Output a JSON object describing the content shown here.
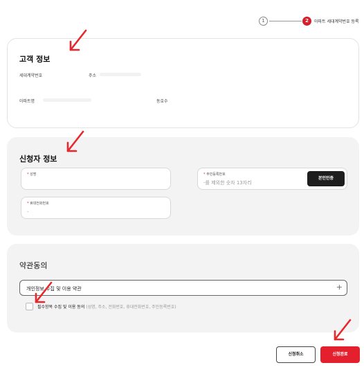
{
  "stepper": {
    "step1_number": "1",
    "step2_number": "2",
    "step2_label": "아파트 세대계약번호 등록"
  },
  "customer": {
    "title": "고객 정보",
    "contract_label": "세대계약번호",
    "address_label": "주소",
    "apartment_label": "아파트명",
    "dong_ho_label": "동호수"
  },
  "applicant": {
    "title": "신청자 정보",
    "name_label": "성명",
    "phone_label": "휴대전화번호",
    "resident_label": "주민등록번호",
    "resident_placeholder": "-를 제외한 숫자 13자리",
    "verify_button": "본인인증",
    "required_mark": "*"
  },
  "terms": {
    "title": "약관동의",
    "row_label": "개인정보 수집 및 이용 약관",
    "checkbox_label": "필수항목 수집 및 이용 동의",
    "checkbox_note": "(성명, 주소, 전화번호, 휴대전화번호, 주민등록번호)"
  },
  "actions": {
    "cancel": "신청취소",
    "complete": "신청완료"
  },
  "colors": {
    "accent": "#e5202e",
    "dark_button": "#1e1e1e",
    "annotation_arrow": "#e8262b"
  },
  "icons": {
    "plus": "+"
  }
}
